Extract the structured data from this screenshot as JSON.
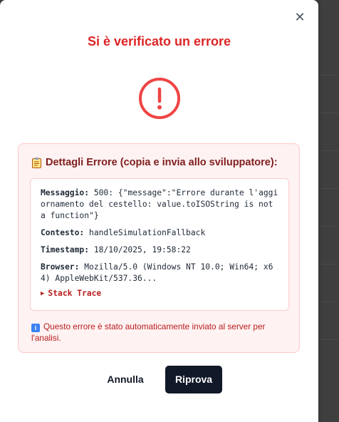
{
  "dialog": {
    "close_glyph": "✕",
    "title": "Si è verificato un errore",
    "icon": "alert-circle-icon",
    "accent_color": "#dc2626"
  },
  "details": {
    "header": "Dettagli Errore (copia e invia allo sviluppatore):",
    "header_icon": "clipboard-icon",
    "message_label": "Messaggio:",
    "message_value": "500: {\"message\":\"Errore durante l'aggiornamento del cestello: value.toISOString is not a function\"}",
    "context_label": "Contesto:",
    "context_value": "handleSimulationFallback",
    "timestamp_label": "Timestamp:",
    "timestamp_value": "18/10/2025, 19:58:22",
    "browser_label": "Browser:",
    "browser_value": "Mozilla/5.0 (Windows NT 10.0; Win64; x64) AppleWebKit/537.36...",
    "stack_trace_label": "Stack Trace",
    "stack_trace_glyph": "▶"
  },
  "notice": {
    "icon": "info-icon",
    "icon_glyph": "i",
    "text": "Questo errore è stato automaticamente inviato al server per l'analisi."
  },
  "actions": {
    "cancel_label": "Annulla",
    "retry_label": "Riprova"
  }
}
